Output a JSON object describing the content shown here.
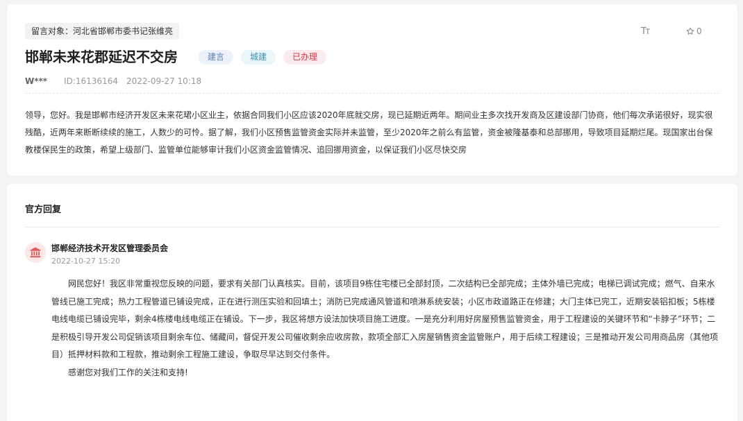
{
  "message": {
    "target": "留言对象：河北省邯郸市委书记张维亮",
    "title": "邯郸未来花郡延迟不交房",
    "tags": [
      "建言",
      "城建",
      "已办理"
    ],
    "author": "W***",
    "id": "ID:16136164",
    "time": "2022-09-27 10:18",
    "font_size_icon": "Tт",
    "favorite_count": "0",
    "content": "领导，您好。我是邯郸市经济开发区未来花珺小区业主，依据合同我们小区应该2020年底就交房，现已延期近两年。期间业主多次找开发商及区建设部门协商，他们每次承诺很好，现实很残酷，近两年来断断续续的施工，人数少的可怜。据了解，我们小区预售监管资金实际并未监管，至少2020年之前么有监管，资金被隆基泰和总部挪用，导致项目延期烂尾。现国家出台保教楼保民生的政策，希望上级部门、监管单位能够审计我们小区资金监管情况、追回挪用资金，以保证我们小区尽快交房"
  },
  "reply": {
    "section_title": "官方回复",
    "org": "邯郸经济技术开发区管理委员会",
    "time": "2022-10-27 15:20",
    "paragraphs": [
      "网民您好！我区非常重视您反映的问题，要求有关部门认真核实。目前，该项目9栋住宅楼已全部封顶，二次结构已全部完成；主体外墙已完成；电梯已调试完成；燃气、自来水管线已施工完成；热力工程管道已铺设完成，正在进行测压实验和回填土；消防已完成通风管道和喷淋系统安装；小区市政道路正在修建；大门主体已完工，近期安装铝扣板；5栋楼电线电缆已铺设完毕，剩余4栋楼电线电缆正在铺设。下一步，我区将想方设法加快项目施工进度。一是充分利用好房屋预售监管资金，用于工程建设的关键环节和“卡脖子”环节；二是积极引导开发公司促销该项目剩余车位、储藏间，督促开发公司催收剩余应收房款，款项全部汇入房屋销售资金监管账户，用于后续工程建设；三是推动开发公司用商品房（其他项目）抵押材料款和工程款，推动剩余工程施工建设，争取尽早达到交付条件。",
      "感谢您对我们工作的关注和支持!"
    ]
  },
  "colors": {
    "tag_blue": "#5b7fb5",
    "tag_cyan": "#3f8fb4",
    "tag_red": "#d9363e",
    "avatar_icon": "#e05a5a"
  },
  "icons": {
    "font_size": "font-size-icon",
    "favorite": "star-outline-icon",
    "avatar": "government-building-icon"
  }
}
